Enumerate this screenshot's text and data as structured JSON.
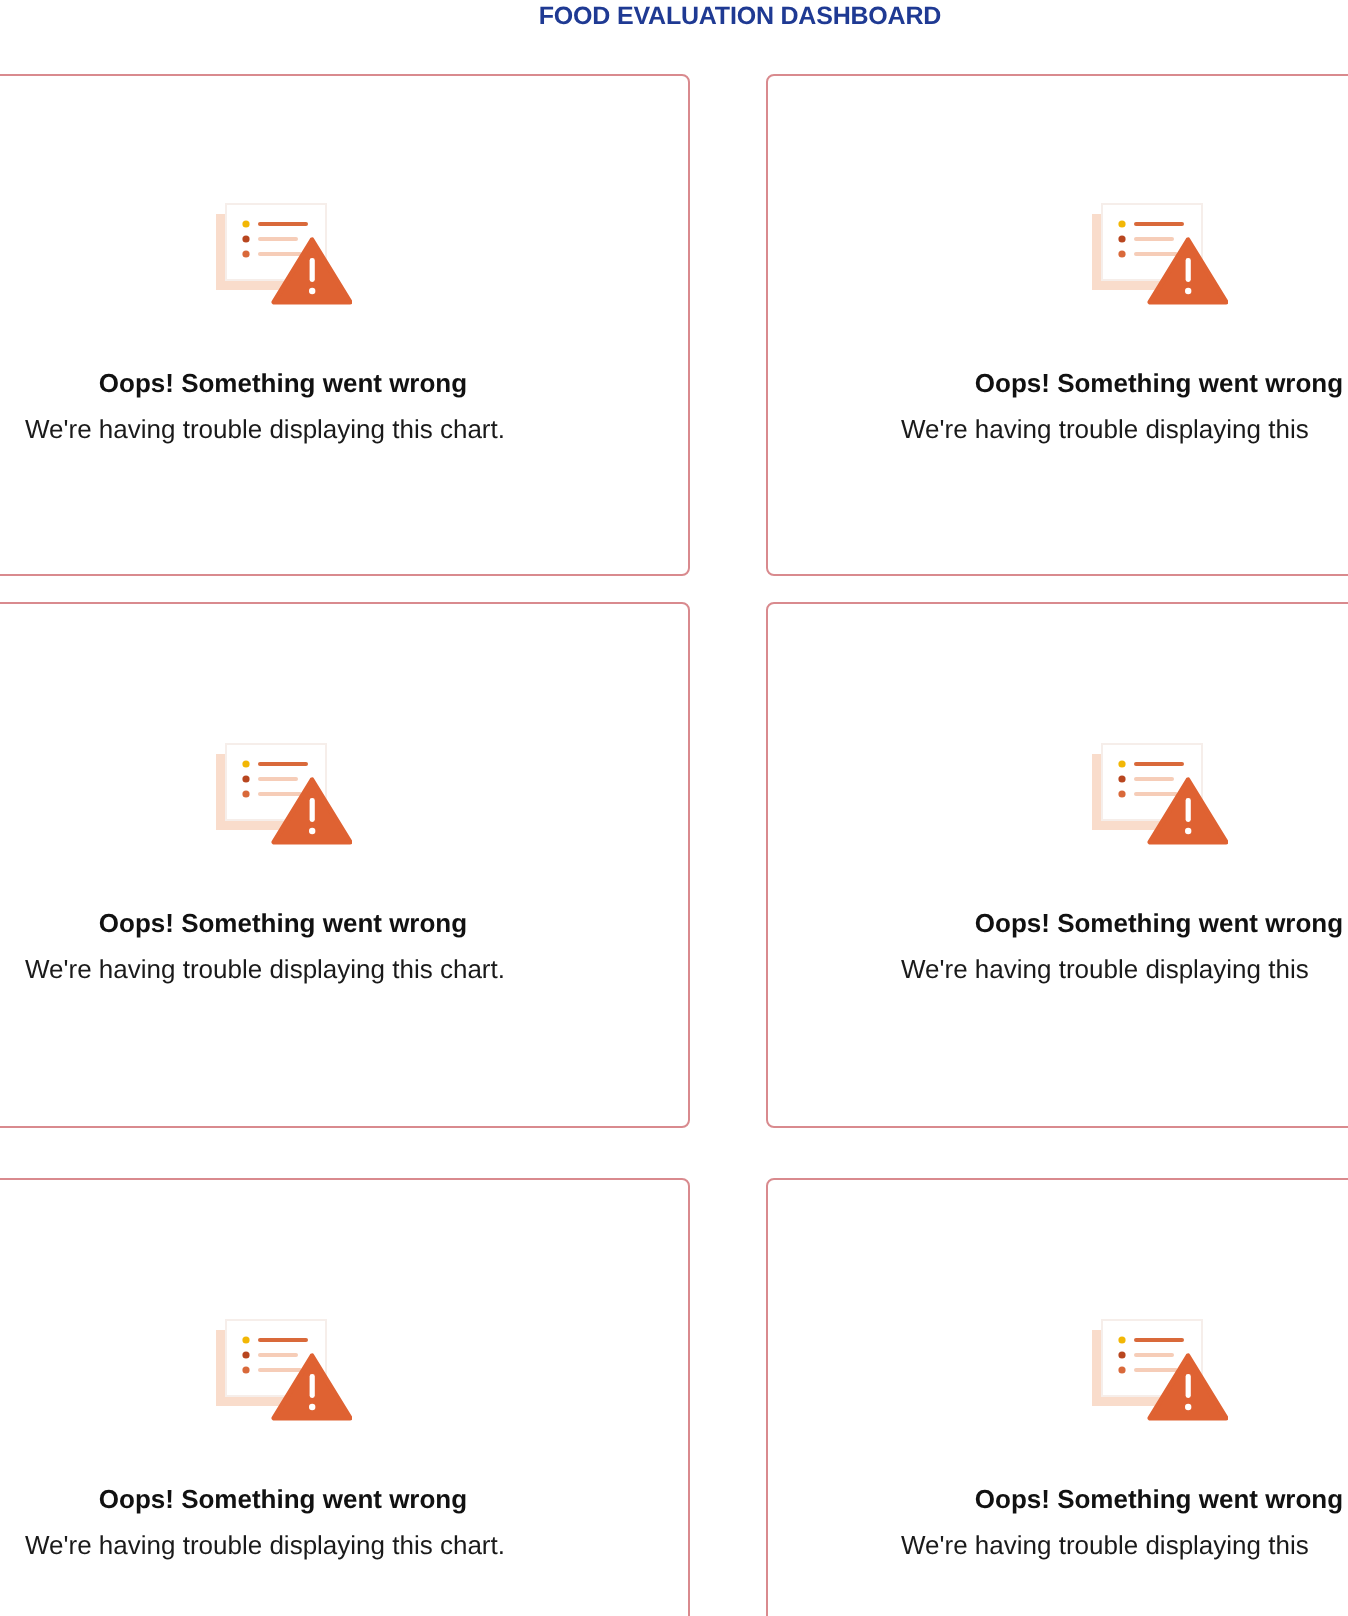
{
  "header": {
    "title": "FOOD EVALUATION DASHBOARD"
  },
  "panels": [
    {
      "error_title": "Oops! Something went wrong",
      "error_message": "We're having trouble displaying this chart."
    },
    {
      "error_title": "Oops! Something went wrong",
      "error_message": "We're having trouble displaying this"
    },
    {
      "error_title": "Oops! Something went wrong",
      "error_message": "We're having trouble displaying this chart."
    },
    {
      "error_title": "Oops! Something went wrong",
      "error_message": "We're having trouble displaying this"
    },
    {
      "error_title": "Oops! Something went wrong",
      "error_message": "We're having trouble displaying this chart."
    },
    {
      "error_title": "Oops! Something went wrong",
      "error_message": "We're having trouble displaying this"
    }
  ]
}
